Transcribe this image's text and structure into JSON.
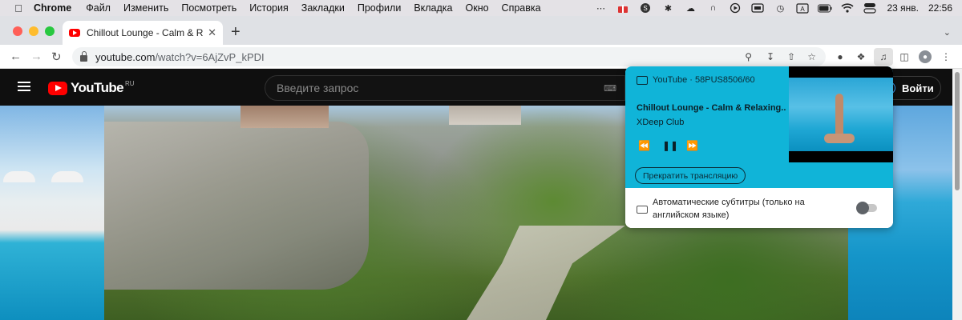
{
  "menubar": {
    "app": "Chrome",
    "items": [
      "Файл",
      "Изменить",
      "Посмотреть",
      "История",
      "Закладки",
      "Профили",
      "Вкладка",
      "Окно",
      "Справка"
    ],
    "date": "23 янв.",
    "time": "22:56"
  },
  "tabs": {
    "active_title": "Chillout Lounge - Calm & Relaxing"
  },
  "omnibox": {
    "url_host": "youtube.com",
    "url_path": "/watch?v=6AjZvP_kPDI"
  },
  "youtube": {
    "logo_text": "YouTube",
    "region": "RU",
    "search_placeholder": "Введите запрос",
    "signin_label": "Войти"
  },
  "cast": {
    "device": "YouTube · 58PUS8506/60",
    "title": "Chillout Lounge - Calm & Relaxing...",
    "artist": "XDeep Club",
    "stop_label": "Прекратить трансляцию",
    "subtitles_label": "Автоматические субтитры (только на английском языке)",
    "subtitles_enabled": false,
    "accent_color": "#10b4d8"
  }
}
